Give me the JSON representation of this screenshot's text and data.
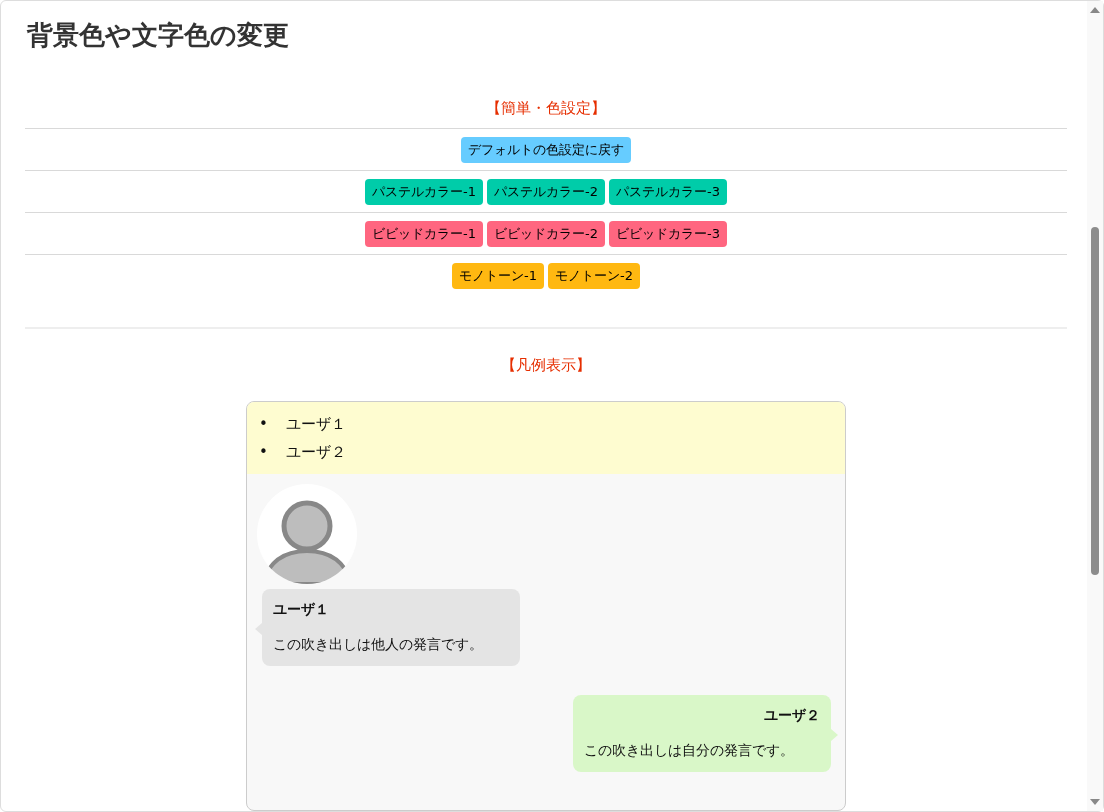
{
  "page_title": "背景色や文字色の変更",
  "color_settings": {
    "heading": "【簡単・色設定】",
    "rows": [
      {
        "color": "#66ccff",
        "buttons": [
          "デフォルトの色設定に戻す"
        ]
      },
      {
        "color": "#00cca9",
        "buttons": [
          "パステルカラー-1",
          "パステルカラー-2",
          "パステルカラー-3"
        ]
      },
      {
        "color": "#ff6680",
        "buttons": [
          "ビビッドカラー-1",
          "ビビッドカラー-2",
          "ビビッドカラー-3"
        ]
      },
      {
        "color": "#ffb811",
        "buttons": [
          "モノトーン-1",
          "モノトーン-2"
        ]
      }
    ]
  },
  "legend": {
    "heading": "【凡例表示】",
    "users": [
      {
        "bullet": "•",
        "name": "ユーザ１"
      },
      {
        "bullet": "•",
        "name": "ユーザ２"
      }
    ],
    "messages": [
      {
        "kind": "other",
        "name": "ユーザ１",
        "text": "この吹き出しは他人の発言です。"
      },
      {
        "kind": "self",
        "name": "ユーザ２",
        "text": "この吹き出しは自分の発言です。"
      }
    ]
  }
}
